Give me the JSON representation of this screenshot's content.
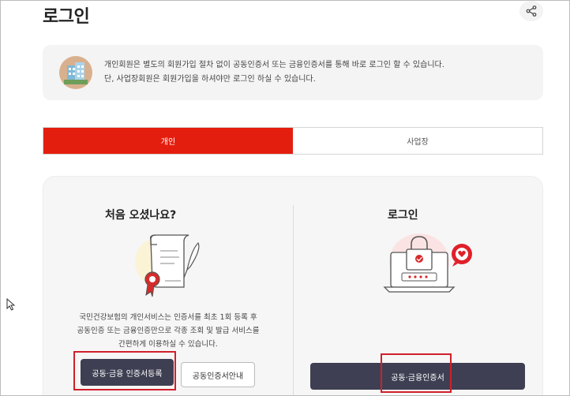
{
  "page": {
    "title": "로그인"
  },
  "notice": {
    "line1": "개인회원은 별도의 회원가입 절차 없이 공동인증서 또는 금융인증서를 통해 바로 로그인 할 수 있습니다.",
    "line2": "단, 사업장회원은 회원가입을 하셔야만 로그인 하실 수 있습니다."
  },
  "tabs": [
    {
      "label": "개인",
      "active": true
    },
    {
      "label": "사업장",
      "active": false
    }
  ],
  "left": {
    "title": "처음 오셨나요?",
    "desc_line1": "국민건강보험의 개인서비스는 인증서를 최초 1회 등록 후",
    "desc_line2": "공동인증 또는 금융인증만으로 각종 조회 및 발급 서비스를",
    "desc_line3": "간편하게 이용하실 수 있습니다.",
    "register_label": "공동·금융 인증서등록",
    "guide_label": "공동인증서안내"
  },
  "right": {
    "title": "로그인",
    "login_label": "공동·금융인증서"
  },
  "colors": {
    "accent": "#e41e0e",
    "dark_button": "#3e3f52",
    "highlight_box": "#d0202a"
  },
  "icons": {
    "share": "share-icon",
    "building": "building-icon",
    "certificate": "certificate-illustration",
    "laptop_lock": "laptop-lock-illustration",
    "chat_heart": "heart-chat-icon",
    "cursor": "mouse-cursor-icon"
  }
}
